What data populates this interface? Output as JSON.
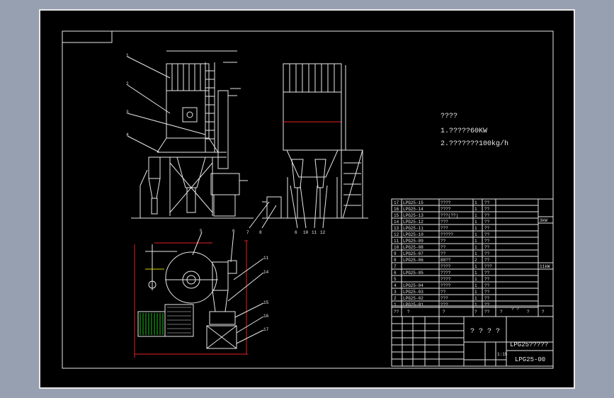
{
  "drawing": {
    "spec_title": "????",
    "spec_line_1": "1.?????60KW",
    "spec_line_2": "2.???????100kg/h",
    "drawing_title": "LPG25?????",
    "drawing_number": "LPG25-00",
    "center_block": "? ? ? ?",
    "scale": "1:15",
    "colors": {
      "sheet": "#000000",
      "line": "#e8e8e8",
      "dim": "#e52020",
      "accent": "#d8d000",
      "hatch": "#18c018"
    }
  },
  "callouts_front": [
    "1",
    "2",
    "3",
    "4"
  ],
  "callouts_side": [
    "6",
    "7",
    "8",
    "10",
    "11",
    "12"
  ],
  "callouts_plan": [
    "5",
    "6",
    "11",
    "14",
    "15",
    "16",
    "17"
  ],
  "bom": [
    {
      "no": "17",
      "code": "LPG25-15",
      "name": "????",
      "qty": "1",
      "mat": "??"
    },
    {
      "no": "16",
      "code": "LPG25-14",
      "name": "????",
      "qty": "1",
      "mat": "??"
    },
    {
      "no": "15",
      "code": "LPG25-13",
      "name": "???(??)",
      "qty": "1",
      "mat": "??"
    },
    {
      "no": "14",
      "code": "LPG25-12",
      "name": "???",
      "qty": "1",
      "mat": "??"
    },
    {
      "no": "13",
      "code": "LPG25-11",
      "name": "???",
      "qty": "1",
      "mat": "??"
    },
    {
      "no": "12",
      "code": "LPG25-10",
      "name": "?????",
      "qty": "1",
      "mat": "??"
    },
    {
      "no": "11",
      "code": "LPG25-09",
      "name": "??",
      "qty": "1",
      "mat": "??"
    },
    {
      "no": "10",
      "code": "LPG25-08",
      "name": "??",
      "qty": "1",
      "mat": "??"
    },
    {
      "no": "9",
      "code": "LPG25-07",
      "name": "??",
      "qty": "1",
      "mat": "??"
    },
    {
      "no": "8",
      "code": "LPG25-06",
      "name": "80??",
      "qty": "2",
      "mat": "??"
    },
    {
      "no": "7",
      "code": "",
      "name": "????",
      "qty": "1",
      "mat": "???"
    },
    {
      "no": "6",
      "code": "LPG25-05",
      "name": "????",
      "qty": "1",
      "mat": "??"
    },
    {
      "no": "5",
      "code": "",
      "name": "????",
      "qty": "1",
      "mat": "??"
    },
    {
      "no": "4",
      "code": "LPG25-04",
      "name": "????",
      "qty": "1",
      "mat": "??"
    },
    {
      "no": "3",
      "code": "LPG25-03",
      "name": "??",
      "qty": "1",
      "mat": "??"
    },
    {
      "no": "2",
      "code": "LPG25-02",
      "name": "???",
      "qty": "1",
      "mat": "??"
    },
    {
      "no": "1",
      "code": "LPG25-01",
      "name": "???",
      "qty": "1",
      "mat": "??"
    }
  ],
  "bom_header": {
    "no": "??",
    "code": "?",
    "name": "?",
    "qty": "?",
    "mat": "??",
    "c6": "?",
    "c7": "? ?",
    "c8": "?",
    "c9": "?"
  },
  "bom_side_notes": {
    "row14": "3kW",
    "row8": "11kW"
  }
}
